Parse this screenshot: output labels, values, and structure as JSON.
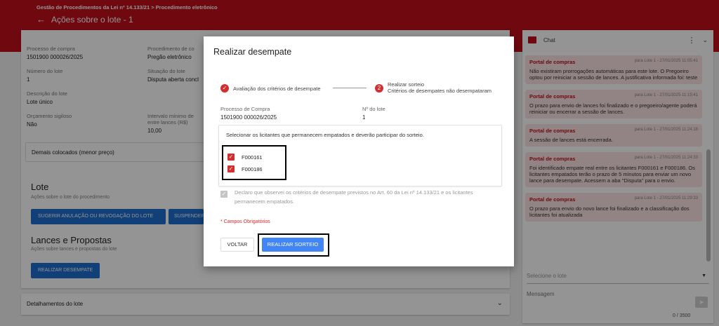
{
  "header": {
    "breadcrumb": "Gestão de Procedimentos da Lei nº 14.133/21 > Procedimento eletrônico",
    "title": "Ações sobre o lote - 1"
  },
  "details": {
    "processo_label": "Processo de compra",
    "processo_value": "1501900 000026/2025",
    "procedimento_label": "Procedimento de co",
    "procedimento_value": "Pregão eletrônico",
    "numero_lote_label": "Número do lote",
    "numero_lote_value": "1",
    "situacao_label": "Situação do lote",
    "situacao_value": "Disputa aberta concl",
    "descricao_label": "Descrição do lote",
    "descricao_value": "Lote único",
    "orcamento_label": "Orçamento sigiloso",
    "orcamento_value": "Não",
    "intervalo_label": "Intervalo mínimo de",
    "intervalo_label2": "entre lances (R$)",
    "intervalo_value": "10,00",
    "demais_label": "Demais colocados (menor preço)"
  },
  "lote_section": {
    "title": "Lote",
    "subtitle": "Ações sobre o lote do procedimento",
    "btn_anulacao": "SUGERIR ANULAÇÃO OU REVOGAÇÃO DO LOTE",
    "btn_suspender": "SUSPENDER"
  },
  "lances_section": {
    "title": "Lances e Propostas",
    "subtitle": "Ações sobre lances e propostas do lote",
    "btn_desempate": "REALIZAR DESEMPATE"
  },
  "detalhamentos": "Detalhamentos do lote",
  "chat": {
    "title": "Chat",
    "messages": [
      {
        "sender": "Portal de compras",
        "meta": "para Lote 1  -  27/01/2025 11:05:41",
        "text": "Não existiram prorrogações automáticas para este lote. O Pregoeiro optou por reiniciar a sessão de lances. A justificativa informada foi: teste"
      },
      {
        "sender": "Portal de compras",
        "meta": "para Lote 1  -  27/01/2025 11:15:41",
        "text": "O prazo para envio de lances foi finalizado e o pregoeiro/agente poderá reiniciar ou encerrar a sessão de lances."
      },
      {
        "sender": "Portal de compras",
        "meta": "para Lote 1  -  27/01/2025 11:24:18",
        "text": "A sessão de lances está encerrada."
      },
      {
        "sender": "Portal de compras",
        "meta": "para Lote 1  -  27/01/2025 11:24:33",
        "text": "Foi identificado empate real entre os licitantes F000161 e F000186. Os licitantes empatados terão o prazo de 5 minutos para enviar um novo lance para desempate. Acessem a aba \"Disputa\" para o envio."
      },
      {
        "sender": "Portal de compras",
        "meta": "para Lote 1  -  27/01/2025 11:29:33",
        "text": "O prazo para envio do novo lance foi finalizado e a classificação dos licitantes foi atualizada"
      }
    ],
    "select_placeholder": "Selecione o lote",
    "message_placeholder": "Mensagem",
    "counter": "0 / 3500"
  },
  "modal": {
    "title": "Realizar desempate",
    "step1_label": "Avaliação dos critérios de desempate",
    "step2_number": "2",
    "step2_label": "Realizar sorteio",
    "step2_sublabel": "Critérios de desempates não desempataram",
    "processo_label": "Processo de Compra",
    "processo_value": "1501900 000026/2025",
    "lote_label": "Nº do lote",
    "lote_value": "1",
    "select_instruction": "Selecionar os licitantes que permanecem empatados e deverão participar do sorteio.",
    "licitantes": [
      "F000161",
      "F000186"
    ],
    "declaration": "Declaro que observei os critérios de desempate previstos no Art. 60 da Lei nº 14.133/21 e os licitantes permanecem empatados.",
    "required_note": "* Campos Obrigatórios",
    "btn_voltar": "VOLTAR",
    "btn_sorteio": "REALIZAR SORTEIO"
  },
  "colors": {
    "brand_red": "#c0101a",
    "primary_blue": "#1e6fcf",
    "button_blue": "#4285f4",
    "chat_bubble": "#fbe3e3"
  }
}
